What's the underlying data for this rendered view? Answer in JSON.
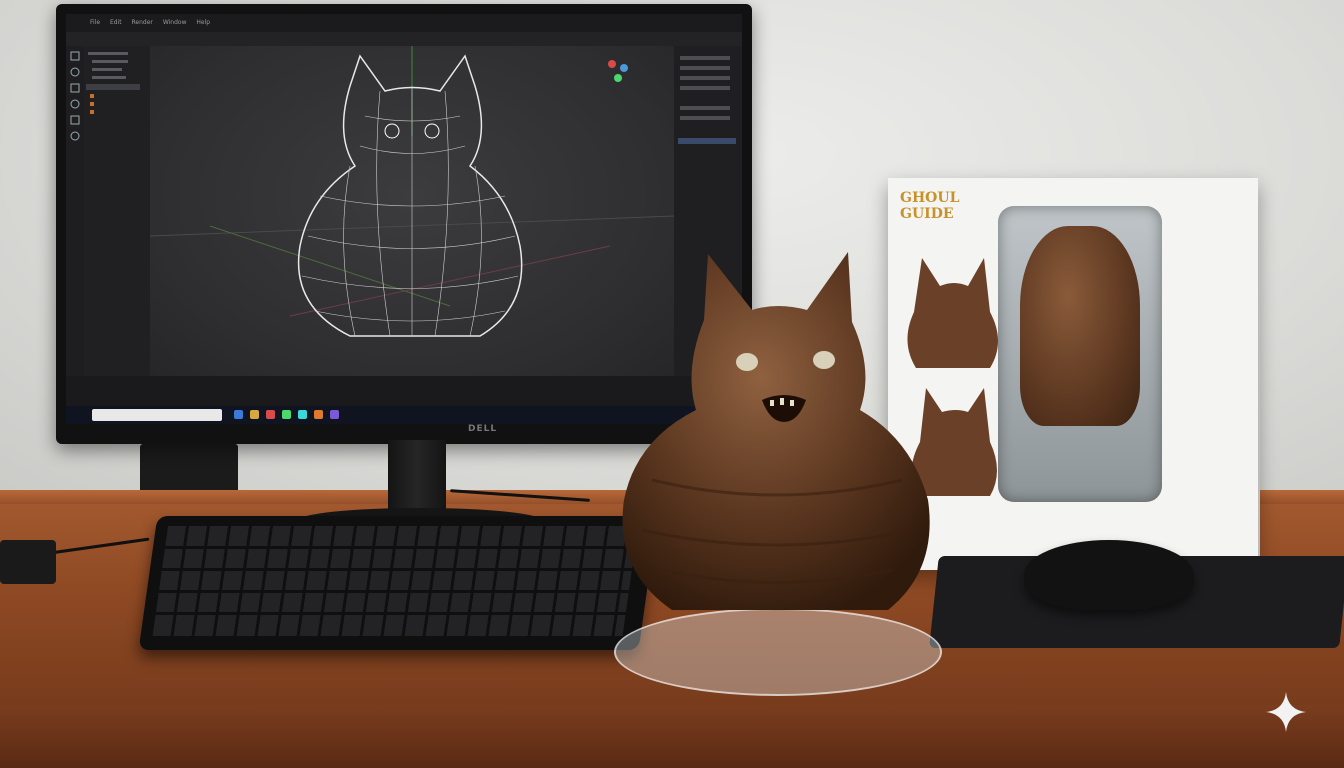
{
  "scene": {
    "description_elements": [
      "monitor",
      "keyboard",
      "figure",
      "packaging-box",
      "mouse"
    ]
  },
  "monitor": {
    "logo_text": "DELL"
  },
  "software": {
    "menu_items": [
      "File",
      "Edit",
      "Render",
      "Window",
      "Help"
    ]
  },
  "box": {
    "brand_line1": "GHOUL",
    "brand_line2": "GUIDE"
  },
  "colors": {
    "figure": "#5c3720",
    "desk": "#9a5128",
    "wall": "#e0e0dd",
    "wireframe": "#e8e8e8"
  }
}
